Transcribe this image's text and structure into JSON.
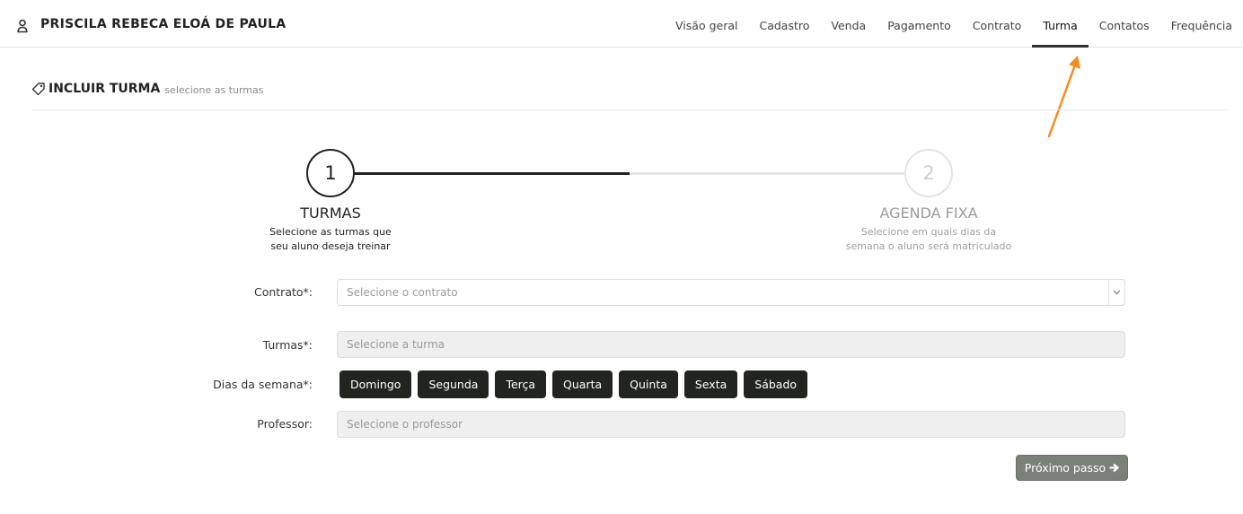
{
  "header": {
    "user_name": "PRISCILA REBECA ELOÁ DE PAULA",
    "user_icon": "user-icon"
  },
  "nav": {
    "items": [
      {
        "label": "Visão geral"
      },
      {
        "label": "Cadastro"
      },
      {
        "label": "Venda"
      },
      {
        "label": "Pagamento"
      },
      {
        "label": "Contrato"
      },
      {
        "label": "Turma"
      },
      {
        "label": "Contatos"
      },
      {
        "label": "Frequência"
      }
    ],
    "active": "Turma"
  },
  "section": {
    "title": "INCLUIR TURMA",
    "subtitle": "selecione as turmas",
    "icon": "tag-icon"
  },
  "wizard": {
    "steps": [
      {
        "number": "1",
        "title": "TURMAS",
        "desc_line1": "Selecione as turmas que",
        "desc_line2": "seu aluno deseja treinar",
        "state": "active"
      },
      {
        "number": "2",
        "title": "AGENDA FIXA",
        "desc_line1": "Selecione em quais dias da",
        "desc_line2": "semana o aluno será matriculado",
        "state": "inactive"
      }
    ]
  },
  "form": {
    "contrato": {
      "label": "Contrato*:",
      "placeholder": "Selecione o contrato"
    },
    "turmas": {
      "label": "Turmas*:",
      "placeholder": "Selecione a turma"
    },
    "dias": {
      "label": "Dias da semana*:",
      "options": [
        "Domingo",
        "Segunda",
        "Terça",
        "Quarta",
        "Quinta",
        "Sexta",
        "Sábado"
      ]
    },
    "professor": {
      "label": "Professor:",
      "placeholder": "Selecione o professor"
    },
    "next_button": "Próximo passo"
  },
  "colors": {
    "accent_dark": "#222222",
    "day_button_bg": "#22251f",
    "next_button_bg": "#7a8179",
    "annotation_arrow": "#f68b1f"
  }
}
